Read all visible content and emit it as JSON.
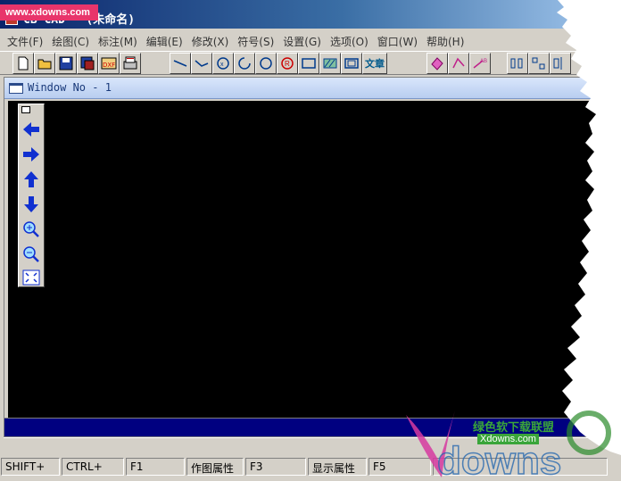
{
  "watermark_top": "www.xdowns.com",
  "app": {
    "title": "CB-CAD - (未命名)"
  },
  "menu": [
    "文件(F)",
    "绘图(C)",
    "标注(M)",
    "编辑(E)",
    "修改(X)",
    "符号(S)",
    "设置(G)",
    "选项(O)",
    "窗口(W)",
    "帮助(H)"
  ],
  "toolbar": {
    "text_button": "文章"
  },
  "child_window": {
    "title": "Window No - 1"
  },
  "palette": {
    "buttons": [
      "arrow-left-icon",
      "arrow-right-icon",
      "arrow-up-icon",
      "arrow-down-icon",
      "zoom-in-icon",
      "zoom-out-icon",
      "fit-window-icon"
    ]
  },
  "statusbar": {
    "cells": [
      "SHIFT+",
      "CTRL+",
      "F1",
      "作图属性",
      "F3",
      "显示属性",
      "F5"
    ]
  },
  "watermark_bottom": {
    "line1": "绿色软下载联盟",
    "line2": "Xdowns.com",
    "big": "downs"
  }
}
